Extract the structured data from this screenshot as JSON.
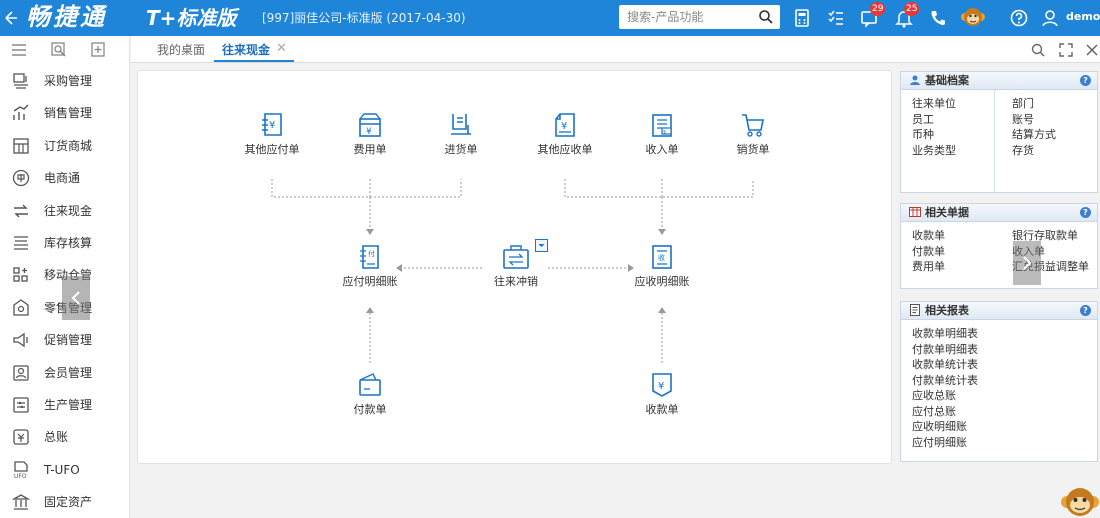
{
  "header": {
    "brand": "畅捷通",
    "edition": "T+标准版",
    "company": "[997]丽佳公司-标准版  (2017-04-30)",
    "search_placeholder": "搜索-产品功能",
    "badges": {
      "messages": "29",
      "notifications": "25"
    },
    "user": "demo",
    "accent": "#1e85d8"
  },
  "sidebar": {
    "items": [
      {
        "label": "采购管理",
        "icon": "purchase-icon"
      },
      {
        "label": "销售管理",
        "icon": "sales-icon"
      },
      {
        "label": "订货商城",
        "icon": "mall-icon"
      },
      {
        "label": "电商通",
        "icon": "ecommerce-icon"
      },
      {
        "label": "往来现金",
        "icon": "cash-flow-icon"
      },
      {
        "label": "库存核算",
        "icon": "inventory-icon"
      },
      {
        "label": "移动仓管",
        "icon": "mobile-warehouse-icon"
      },
      {
        "label": "零售管理",
        "icon": "retail-icon"
      },
      {
        "label": "促销管理",
        "icon": "promotion-icon"
      },
      {
        "label": "会员管理",
        "icon": "member-icon"
      },
      {
        "label": "生产管理",
        "icon": "production-icon"
      },
      {
        "label": "总账",
        "icon": "ledger-icon"
      },
      {
        "label": "T-UFO",
        "icon": "ufo-icon"
      },
      {
        "label": "固定资产",
        "icon": "fixed-asset-icon"
      }
    ]
  },
  "tabs": [
    {
      "label": "我的桌面"
    },
    {
      "label": "往来现金"
    }
  ],
  "flow": {
    "top_nodes": [
      {
        "label": "其他应付单"
      },
      {
        "label": "费用单"
      },
      {
        "label": "进货单"
      },
      {
        "label": "其他应收单"
      },
      {
        "label": "收入单"
      },
      {
        "label": "销货单"
      }
    ],
    "payable_detail": "应付明细账",
    "offset": "往来冲销",
    "receivable_detail": "应收明细账",
    "payment": "付款单",
    "receipt": "收款单"
  },
  "panels": {
    "basic": {
      "title": "基础档案",
      "left": [
        "往来单位",
        "员工",
        "币种",
        "业务类型"
      ],
      "right": [
        "部门",
        "账号",
        "结算方式",
        "存货"
      ]
    },
    "related_docs": {
      "title": "相关单据",
      "left": [
        "收款单",
        "付款单",
        "费用单"
      ],
      "right": [
        "银行存取款单",
        "收入单",
        "汇兑损益调整单"
      ]
    },
    "related_reports": {
      "title": "相关报表",
      "items": [
        "收款单明细表",
        "付款单明细表",
        "收款单统计表",
        "付款单统计表",
        "应收总账",
        "应付总账",
        "应收明细账",
        "应付明细账"
      ]
    }
  }
}
